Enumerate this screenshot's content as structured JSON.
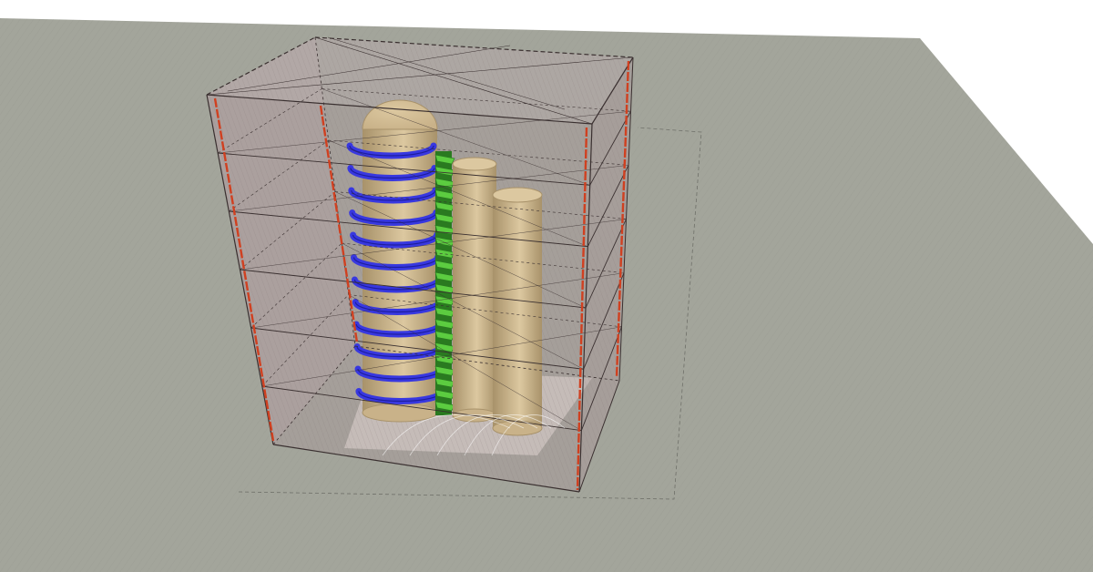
{
  "colors": {
    "sky": "#ffffff",
    "ground": "#a3a59b",
    "ground_shade": "#9a9c93",
    "enclosure_fill": "#b7a9a9",
    "enclosure_front": "#a89999",
    "frame_edge": "#3a3030",
    "red_post": "#d04020",
    "tank": "#c9b289",
    "tank_shade": "#a8926a",
    "tank_light": "#dcc8a0",
    "blue_coil": "#3838e0",
    "blue_coil_dark": "#1e1e9c",
    "green_fins": "#5ccc40",
    "green_fins_dark": "#2a7a20",
    "floor_pad": "#e6e2dc"
  },
  "scene": {
    "objects": [
      "ground-plane",
      "floor-pad",
      "enclosure-frame",
      "corner-post",
      "column-tank",
      "helical-coil",
      "finned-tube",
      "cylinder-tank"
    ],
    "coil_turns": 12,
    "fin_count": 22,
    "shelf_levels": 5
  }
}
